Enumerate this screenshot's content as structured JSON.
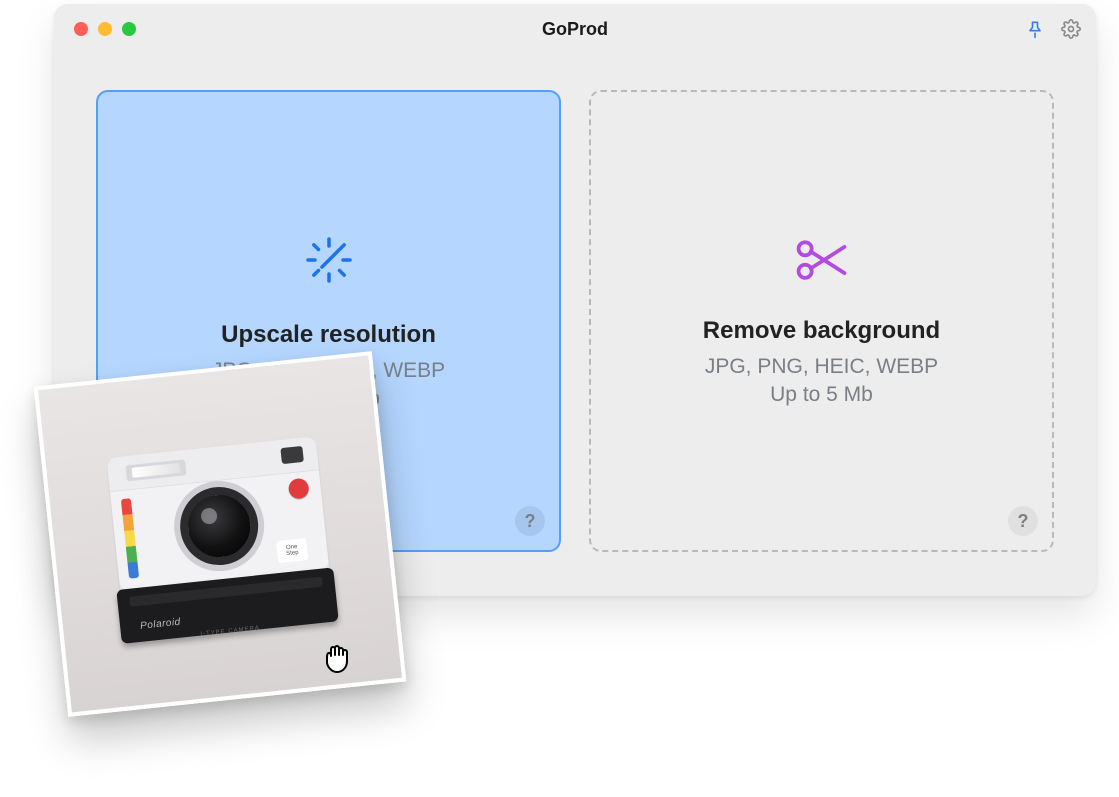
{
  "window": {
    "title": "GoProd"
  },
  "titlebar": {
    "pin_icon": "pin-icon",
    "settings_icon": "gear-icon"
  },
  "cards": {
    "upscale": {
      "title": "Upscale resolution",
      "formats": "JPG, PNG, HEIC, WEBP",
      "limit": "Up to 5 Mb",
      "help": "?",
      "icon": "magic-wand-sparkle-icon",
      "state": "active"
    },
    "removebg": {
      "title": "Remove background",
      "formats": "JPG, PNG, HEIC, WEBP",
      "limit": "Up to 5 Mb",
      "help": "?",
      "icon": "scissors-icon",
      "state": "idle"
    }
  },
  "drag": {
    "item_desc": "Polaroid instant camera photo",
    "brand_label": "Polaroid",
    "cursor": "grabbing"
  },
  "colors": {
    "accent_blue": "#2f80ed",
    "active_bg": "#b4d6ff",
    "active_border": "#51a0fb",
    "scissors": "#b44be0"
  }
}
